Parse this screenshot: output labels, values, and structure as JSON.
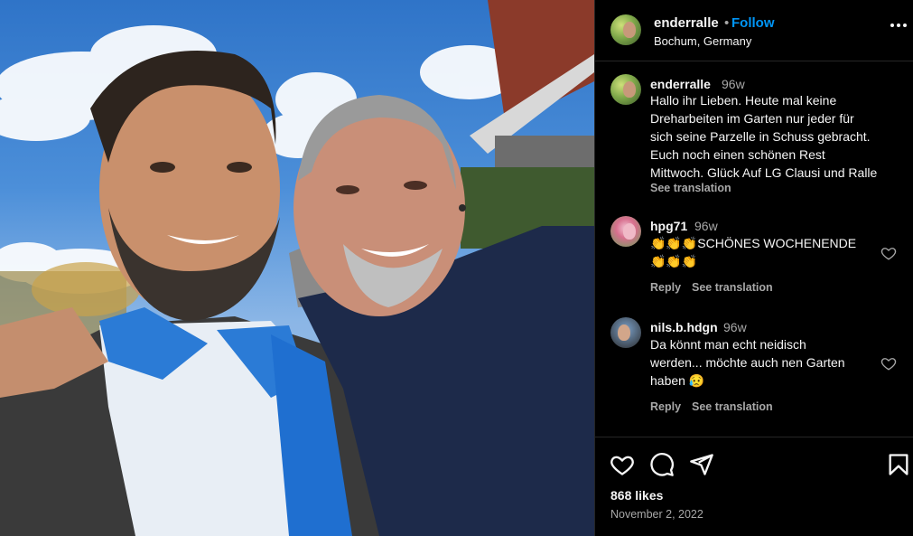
{
  "post": {
    "username": "enderralle",
    "dot": "•",
    "follow_label": "Follow",
    "location": "Bochum, Germany",
    "more_icon": "more-horizontal-icon"
  },
  "comments": [
    {
      "username": "enderralle",
      "time": "96w",
      "lines": [
        "Hallo ihr Lieben. Heute mal keine",
        "Dreharbeiten im Garten nur jeder für",
        "sich seine Parzelle in Schuss gebracht.",
        "Euch noch einen schönen Rest",
        "Mittwoch. Glück Auf LG Clausi und Ralle"
      ],
      "see_translation": "See translation"
    },
    {
      "username": "hpg71",
      "time": "96w",
      "lines": [
        "👏👏👏SCHÖNES WOCHENENDE",
        "👏👏👏"
      ],
      "reply": "Reply",
      "see_translation": "See translation"
    },
    {
      "username": "nils.b.hdgn",
      "time": "96w",
      "lines": [
        "Da könnt man echt neidisch",
        "werden... möchte auch nen Garten",
        "haben 😥"
      ],
      "reply": "Reply",
      "see_translation": "See translation"
    }
  ],
  "actions": {
    "like_icon": "heart-icon",
    "comment_icon": "comment-icon",
    "share_icon": "share-icon",
    "save_icon": "bookmark-icon",
    "likes": "868 likes",
    "date": "November 2, 2022"
  },
  "colors": {
    "background": "#000000",
    "accent": "#0095f6",
    "secondary_text": "#a8a8a8",
    "divider": "#262626"
  }
}
